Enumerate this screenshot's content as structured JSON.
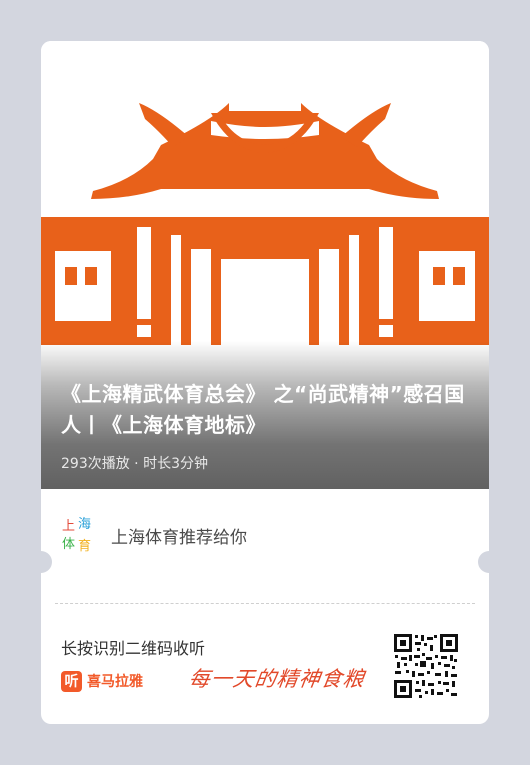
{
  "colors": {
    "background": "#d3d6df",
    "card": "#ffffff",
    "building": "#e8611a",
    "brand": "#f25a2a"
  },
  "episode": {
    "title": "《上海精武体育总会》 之“尚武精神”感召国人丨《上海体育地标》",
    "meta": "293次播放 · 时长3分钟",
    "cover_icon": "temple-building-illustration"
  },
  "recommender": {
    "logo_icon": "shanghai-sports-logo-icon",
    "text": "上海体育推荐给你"
  },
  "footer": {
    "label": "长按识别二维码收听",
    "brand_badge": "听",
    "brand_name": "喜马拉雅",
    "slogan": "每一天的精神食粮",
    "qr_icon": "qr-code-icon"
  }
}
